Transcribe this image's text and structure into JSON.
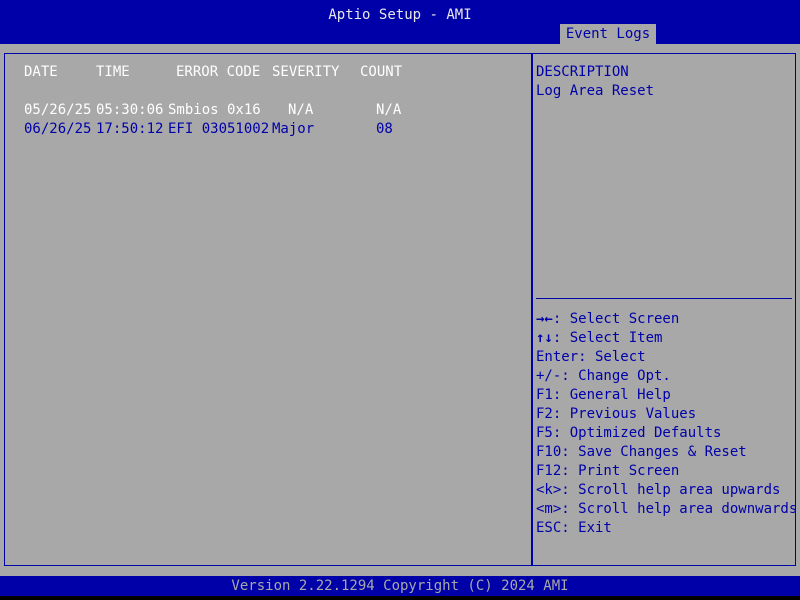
{
  "app": {
    "title": "Aptio Setup - AMI"
  },
  "tabs": [
    {
      "label": "Event Logs",
      "active": true
    }
  ],
  "log_table": {
    "headers": [
      "DATE",
      "TIME",
      "ERROR CODE",
      "SEVERITY",
      "COUNT"
    ],
    "rows": [
      {
        "date": "05/26/25",
        "time": "05:30:06",
        "error_code": "Smbios 0x16",
        "severity": "N/A",
        "count": "N/A",
        "highlighted": false
      },
      {
        "date": "06/26/25",
        "time": "17:50:12",
        "error_code": "EFI 03051002",
        "severity": "Major",
        "count": "08",
        "highlighted": true
      }
    ]
  },
  "description": {
    "heading": "DESCRIPTION",
    "text": "Log Area Reset"
  },
  "help": [
    {
      "key": "→←",
      "text": ": Select Screen"
    },
    {
      "key": "↑↓",
      "text": ": Select Item"
    },
    {
      "key": "",
      "text": "Enter: Select"
    },
    {
      "key": "",
      "text": "+/-: Change Opt."
    },
    {
      "key": "",
      "text": "F1: General Help"
    },
    {
      "key": "",
      "text": "F2: Previous Values"
    },
    {
      "key": "",
      "text": "F5: Optimized Defaults"
    },
    {
      "key": "",
      "text": "F10: Save Changes & Reset"
    },
    {
      "key": "",
      "text": "F12: Print Screen"
    },
    {
      "key": "",
      "text": "<k>: Scroll help area upwards"
    },
    {
      "key": "",
      "text": "<m>: Scroll help area downwards"
    },
    {
      "key": "",
      "text": "ESC: Exit"
    }
  ],
  "footer": {
    "text": "Version 2.22.1294 Copyright (C) 2024 AMI"
  },
  "colors": {
    "bios_blue": "#0000a8",
    "panel_gray": "#a8a8a8",
    "selected_text": "#ffffff"
  }
}
